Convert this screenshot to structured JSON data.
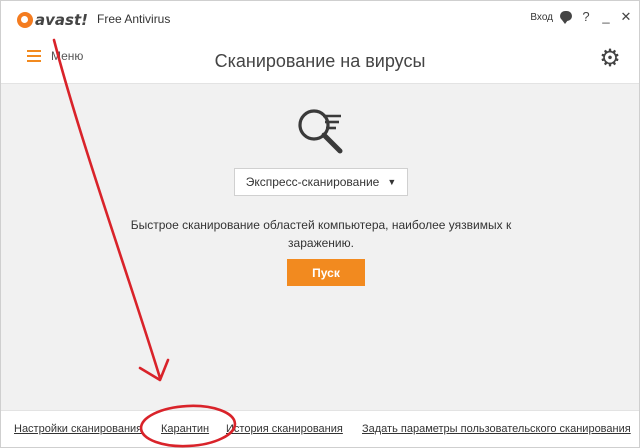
{
  "app": {
    "logo_text": "avast!",
    "product": "Free Antivirus"
  },
  "titlebar": {
    "login_label": "Вход",
    "icons": [
      "chat-icon",
      "help-icon",
      "minimize-icon",
      "close-icon"
    ],
    "help_glyph": "?",
    "minimize_glyph": "_",
    "close_glyph": "✕"
  },
  "header": {
    "menu_label": "Меню",
    "title": "Сканирование на вирусы",
    "settings_icon": "gear-icon"
  },
  "main": {
    "scan_icon": "magnifier-icon",
    "scan_type": {
      "selected": "Экспресс-сканирование"
    },
    "description": "Быстрое сканирование областей компьютера, наиболее уязвимых к заражению.",
    "start_label": "Пуск"
  },
  "footer": {
    "links": [
      "Настройки сканирования",
      "Карантин",
      "История сканирования",
      "Задать параметры пользовательского сканирования"
    ]
  },
  "colors": {
    "accent": "#f28a1f",
    "annotation": "#d9232a",
    "content_bg": "#f1f1f1"
  }
}
